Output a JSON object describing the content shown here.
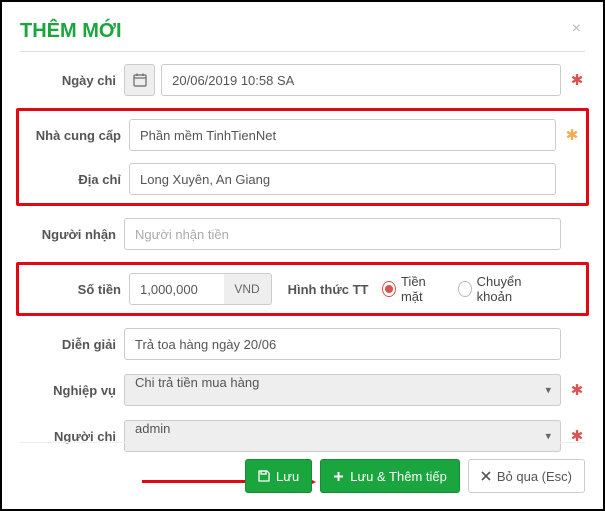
{
  "title": "THÊM MỚI",
  "labels": {
    "date": "Ngày chi",
    "supplier": "Nhà cung cấp",
    "address": "Địa chỉ",
    "receiver": "Người nhận",
    "amount": "Số tiền",
    "payMethod": "Hình thức TT",
    "description": "Diễn giải",
    "operation": "Nghiệp vụ",
    "spender": "Người chi"
  },
  "date": "20/06/2019 10:58 SA",
  "supplier": "Phần mềm TinhTienNet",
  "address": "Long Xuyên, An Giang",
  "receiverPlaceholder": "Người nhận tiền",
  "amount": "1,000,000",
  "currency": "VND",
  "payOptions": {
    "cash": "Tiền mặt",
    "transfer": "Chuyển khoản"
  },
  "paySelected": "cash",
  "description": "Trả toa hàng ngày 20/06",
  "operation": "Chi trả tiền mua hàng",
  "spender": "admin",
  "buttons": {
    "save": "Lưu",
    "saveNext": "Lưu & Thêm tiếp",
    "skip": "Bỏ qua (Esc)"
  }
}
